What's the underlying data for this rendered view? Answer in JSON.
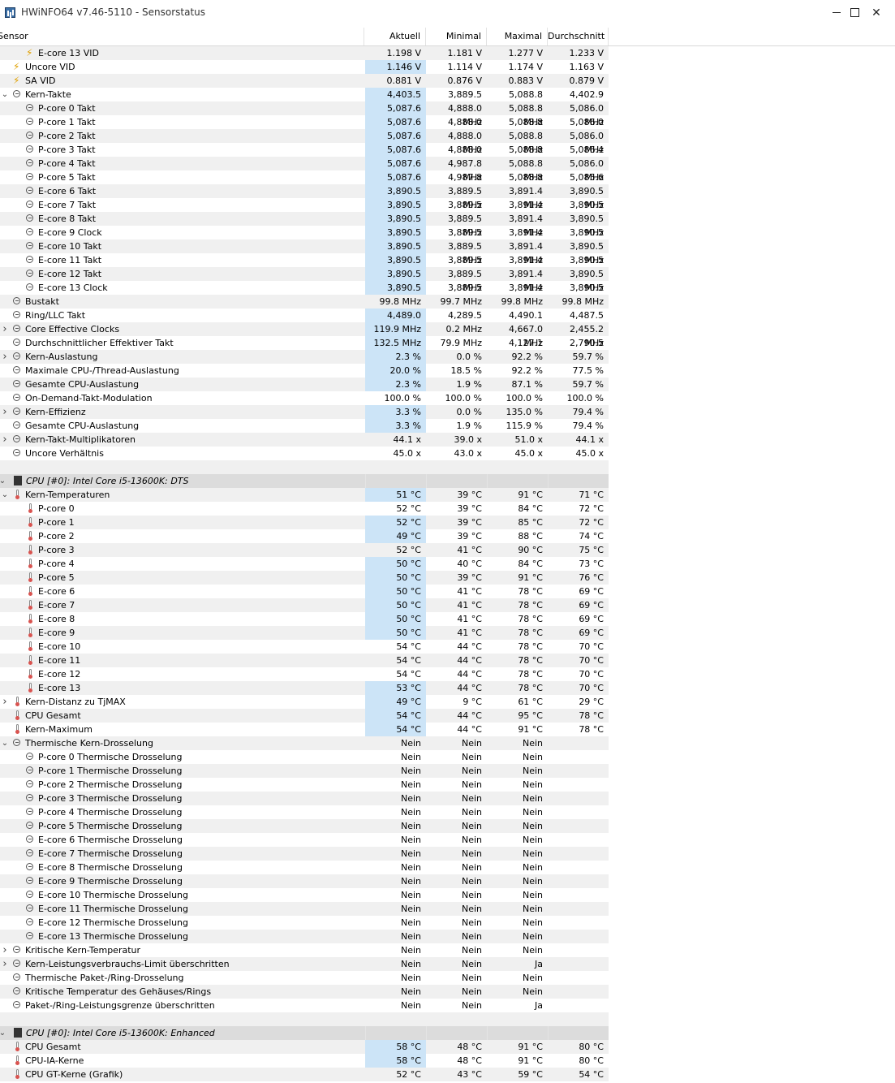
{
  "window": {
    "title": "HWiNFO64 v7.46-5110 - Sensorstatus",
    "minimize_label": "—",
    "maximize_label": "☐",
    "close_label": "✕"
  },
  "columns": [
    "Sensor",
    "Aktuell",
    "Minimal",
    "Maximal",
    "Durchschnitt"
  ],
  "colors": {
    "highlight": "#cce4f7",
    "group_row": "#dcdcdc",
    "alt_row": "#f0f0f0"
  },
  "rows": [
    {
      "indent": 2,
      "exp": "",
      "icon": "volt",
      "label": "E-core 13 VID",
      "v": [
        "1.198 V",
        "1.181 V",
        "1.277 V",
        "1.233 V"
      ],
      "hl": false
    },
    {
      "indent": 1,
      "exp": "",
      "icon": "volt",
      "label": "Uncore VID",
      "v": [
        "1.146 V",
        "1.114 V",
        "1.174 V",
        "1.163 V"
      ],
      "hl": true
    },
    {
      "indent": 1,
      "exp": "",
      "icon": "volt",
      "label": "SA VID",
      "v": [
        "0.881 V",
        "0.876 V",
        "0.883 V",
        "0.879 V"
      ],
      "hl": false
    },
    {
      "indent": 1,
      "exp": "down",
      "icon": "clock",
      "label": "Kern-Takte",
      "v": [
        "4,403.5 MHz",
        "3,889.5 MHz",
        "5,088.8 MHz",
        "4,402.9 MHz"
      ],
      "hl": true
    },
    {
      "indent": 2,
      "exp": "",
      "icon": "clock",
      "label": "P-core 0 Takt",
      "v": [
        "5,087.6 MHz",
        "4,888.0 MHz",
        "5,088.8 MHz",
        "5,086.0 MHz"
      ],
      "hl": true
    },
    {
      "indent": 2,
      "exp": "",
      "icon": "clock",
      "label": "P-core 1 Takt",
      "v": [
        "5,087.6 MHz",
        "4,888.0 MHz",
        "5,088.8 MHz",
        "5,086.0 MHz"
      ],
      "hl": true
    },
    {
      "indent": 2,
      "exp": "",
      "icon": "clock",
      "label": "P-core 2 Takt",
      "v": [
        "5,087.6 MHz",
        "4,888.0 MHz",
        "5,088.8 MHz",
        "5,086.0 MHz"
      ],
      "hl": true
    },
    {
      "indent": 2,
      "exp": "",
      "icon": "clock",
      "label": "P-core 3 Takt",
      "v": [
        "5,087.6 MHz",
        "4,888.0 MHz",
        "5,088.8 MHz",
        "5,086.4 MHz"
      ],
      "hl": true
    },
    {
      "indent": 2,
      "exp": "",
      "icon": "clock",
      "label": "P-core 4 Takt",
      "v": [
        "5,087.6 MHz",
        "4,987.8 MHz",
        "5,088.8 MHz",
        "5,086.0 MHz"
      ],
      "hl": true
    },
    {
      "indent": 2,
      "exp": "",
      "icon": "clock",
      "label": "P-core 5 Takt",
      "v": [
        "5,087.6 MHz",
        "4,987.8 MHz",
        "5,088.8 MHz",
        "5,085.6 MHz"
      ],
      "hl": true
    },
    {
      "indent": 2,
      "exp": "",
      "icon": "clock",
      "label": "E-core 6 Takt",
      "v": [
        "3,890.5 MHz",
        "3,889.5 MHz",
        "3,891.4 MHz",
        "3,890.5 MHz"
      ],
      "hl": true
    },
    {
      "indent": 2,
      "exp": "",
      "icon": "clock",
      "label": "E-core 7 Takt",
      "v": [
        "3,890.5 MHz",
        "3,889.5 MHz",
        "3,891.4 MHz",
        "3,890.5 MHz"
      ],
      "hl": true
    },
    {
      "indent": 2,
      "exp": "",
      "icon": "clock",
      "label": "E-core 8 Takt",
      "v": [
        "3,890.5 MHz",
        "3,889.5 MHz",
        "3,891.4 MHz",
        "3,890.5 MHz"
      ],
      "hl": true
    },
    {
      "indent": 2,
      "exp": "",
      "icon": "clock",
      "label": "E-core 9 Clock",
      "v": [
        "3,890.5 MHz",
        "3,889.5 MHz",
        "3,891.4 MHz",
        "3,890.5 MHz"
      ],
      "hl": true
    },
    {
      "indent": 2,
      "exp": "",
      "icon": "clock",
      "label": "E-core 10 Takt",
      "v": [
        "3,890.5 MHz",
        "3,889.5 MHz",
        "3,891.4 MHz",
        "3,890.5 MHz"
      ],
      "hl": true
    },
    {
      "indent": 2,
      "exp": "",
      "icon": "clock",
      "label": "E-core 11 Takt",
      "v": [
        "3,890.5 MHz",
        "3,889.5 MHz",
        "3,891.4 MHz",
        "3,890.5 MHz"
      ],
      "hl": true
    },
    {
      "indent": 2,
      "exp": "",
      "icon": "clock",
      "label": "E-core 12 Takt",
      "v": [
        "3,890.5 MHz",
        "3,889.5 MHz",
        "3,891.4 MHz",
        "3,890.5 MHz"
      ],
      "hl": true
    },
    {
      "indent": 2,
      "exp": "",
      "icon": "clock",
      "label": "E-core 13 Clock",
      "v": [
        "3,890.5 MHz",
        "3,889.5 MHz",
        "3,891.4 MHz",
        "3,890.5 MHz"
      ],
      "hl": true
    },
    {
      "indent": 1,
      "exp": "",
      "icon": "clock",
      "label": "Bustakt",
      "v": [
        "99.8 MHz",
        "99.7 MHz",
        "99.8 MHz",
        "99.8 MHz"
      ],
      "hl": false
    },
    {
      "indent": 1,
      "exp": "",
      "icon": "clock",
      "label": "Ring/LLC Takt",
      "v": [
        "4,489.0 MHz",
        "4,289.5 MHz",
        "4,490.1 MHz",
        "4,487.5 MHz"
      ],
      "hl": true
    },
    {
      "indent": 1,
      "exp": "right",
      "icon": "clock",
      "label": "Core Effective Clocks",
      "v": [
        "119.9 MHz",
        "0.2 MHz",
        "4,667.0 MHz",
        "2,455.2 MHz"
      ],
      "hl": true,
      "sub": true
    },
    {
      "indent": 1,
      "exp": "",
      "icon": "clock",
      "label": "Durchschnittlicher Effektiver Takt",
      "v": [
        "132.5 MHz",
        "79.9 MHz",
        "4,127.1 MHz",
        "2,790.5 MHz"
      ],
      "hl": true
    },
    {
      "indent": 1,
      "exp": "right",
      "icon": "clock",
      "label": "Kern-Auslastung",
      "v": [
        "2.3 %",
        "0.0 %",
        "92.2 %",
        "59.7 %"
      ],
      "hl": true,
      "sub": true
    },
    {
      "indent": 1,
      "exp": "",
      "icon": "clock",
      "label": "Maximale CPU-/Thread-Auslastung",
      "v": [
        "20.0 %",
        "18.5 %",
        "92.2 %",
        "77.5 %"
      ],
      "hl": true
    },
    {
      "indent": 1,
      "exp": "",
      "icon": "clock",
      "label": "Gesamte CPU-Auslastung",
      "v": [
        "2.3 %",
        "1.9 %",
        "87.1 %",
        "59.7 %"
      ],
      "hl": true
    },
    {
      "indent": 1,
      "exp": "",
      "icon": "clock",
      "label": "On-Demand-Takt-Modulation",
      "v": [
        "100.0 %",
        "100.0 %",
        "100.0 %",
        "100.0 %"
      ],
      "hl": false
    },
    {
      "indent": 1,
      "exp": "right",
      "icon": "clock",
      "label": "Kern-Effizienz",
      "v": [
        "3.3 %",
        "0.0 %",
        "135.0 %",
        "79.4 %"
      ],
      "hl": true,
      "sub": true
    },
    {
      "indent": 1,
      "exp": "",
      "icon": "clock",
      "label": "Gesamte CPU-Auslastung",
      "v": [
        "3.3 %",
        "1.9 %",
        "115.9 %",
        "79.4 %"
      ],
      "hl": true
    },
    {
      "indent": 1,
      "exp": "right",
      "icon": "clock",
      "label": "Kern-Takt-Multiplikatoren",
      "v": [
        "44.1 x",
        "39.0 x",
        "51.0 x",
        "44.1 x"
      ],
      "hl": false,
      "sub": true
    },
    {
      "indent": 1,
      "exp": "",
      "icon": "clock",
      "label": "Uncore Verhältnis",
      "v": [
        "45.0 x",
        "43.0 x",
        "45.0 x",
        "45.0 x"
      ],
      "hl": false
    },
    {
      "blank": true
    },
    {
      "group": true,
      "exp": "down",
      "icon": "cpu",
      "label": "CPU [#0]: Intel Core i5-13600K: DTS"
    },
    {
      "indent": 1,
      "exp": "down",
      "icon": "temp",
      "label": "Kern-Temperaturen",
      "v": [
        "51 °C",
        "39 °C",
        "91 °C",
        "71 °C"
      ],
      "hl": true,
      "sub": true
    },
    {
      "indent": 2,
      "exp": "",
      "icon": "temp",
      "label": "P-core 0",
      "v": [
        "52 °C",
        "39 °C",
        "84 °C",
        "72 °C"
      ],
      "hl": false
    },
    {
      "indent": 2,
      "exp": "",
      "icon": "temp",
      "label": "P-core 1",
      "v": [
        "52 °C",
        "39 °C",
        "85 °C",
        "72 °C"
      ],
      "hl": true
    },
    {
      "indent": 2,
      "exp": "",
      "icon": "temp",
      "label": "P-core 2",
      "v": [
        "49 °C",
        "39 °C",
        "88 °C",
        "74 °C"
      ],
      "hl": true
    },
    {
      "indent": 2,
      "exp": "",
      "icon": "temp",
      "label": "P-core 3",
      "v": [
        "52 °C",
        "41 °C",
        "90 °C",
        "75 °C"
      ],
      "hl": false
    },
    {
      "indent": 2,
      "exp": "",
      "icon": "temp",
      "label": "P-core 4",
      "v": [
        "50 °C",
        "40 °C",
        "84 °C",
        "73 °C"
      ],
      "hl": true
    },
    {
      "indent": 2,
      "exp": "",
      "icon": "temp",
      "label": "P-core 5",
      "v": [
        "50 °C",
        "39 °C",
        "91 °C",
        "76 °C"
      ],
      "hl": true
    },
    {
      "indent": 2,
      "exp": "",
      "icon": "temp",
      "label": "E-core 6",
      "v": [
        "50 °C",
        "41 °C",
        "78 °C",
        "69 °C"
      ],
      "hl": true
    },
    {
      "indent": 2,
      "exp": "",
      "icon": "temp",
      "label": "E-core 7",
      "v": [
        "50 °C",
        "41 °C",
        "78 °C",
        "69 °C"
      ],
      "hl": true
    },
    {
      "indent": 2,
      "exp": "",
      "icon": "temp",
      "label": "E-core 8",
      "v": [
        "50 °C",
        "41 °C",
        "78 °C",
        "69 °C"
      ],
      "hl": true
    },
    {
      "indent": 2,
      "exp": "",
      "icon": "temp",
      "label": "E-core 9",
      "v": [
        "50 °C",
        "41 °C",
        "78 °C",
        "69 °C"
      ],
      "hl": true
    },
    {
      "indent": 2,
      "exp": "",
      "icon": "temp",
      "label": "E-core 10",
      "v": [
        "54 °C",
        "44 °C",
        "78 °C",
        "70 °C"
      ],
      "hl": false
    },
    {
      "indent": 2,
      "exp": "",
      "icon": "temp",
      "label": "E-core 11",
      "v": [
        "54 °C",
        "44 °C",
        "78 °C",
        "70 °C"
      ],
      "hl": false
    },
    {
      "indent": 2,
      "exp": "",
      "icon": "temp",
      "label": "E-core 12",
      "v": [
        "54 °C",
        "44 °C",
        "78 °C",
        "70 °C"
      ],
      "hl": false
    },
    {
      "indent": 2,
      "exp": "",
      "icon": "temp",
      "label": "E-core 13",
      "v": [
        "53 °C",
        "44 °C",
        "78 °C",
        "70 °C"
      ],
      "hl": true
    },
    {
      "indent": 1,
      "exp": "right",
      "icon": "temp",
      "label": "Kern-Distanz zu TjMAX",
      "v": [
        "49 °C",
        "9 °C",
        "61 °C",
        "29 °C"
      ],
      "hl": true,
      "sub": true
    },
    {
      "indent": 1,
      "exp": "",
      "icon": "temp",
      "label": "CPU Gesamt",
      "v": [
        "54 °C",
        "44 °C",
        "95 °C",
        "78 °C"
      ],
      "hl": true
    },
    {
      "indent": 1,
      "exp": "",
      "icon": "temp",
      "label": "Kern-Maximum",
      "v": [
        "54 °C",
        "44 °C",
        "91 °C",
        "78 °C"
      ],
      "hl": true
    },
    {
      "indent": 1,
      "exp": "down",
      "icon": "clock",
      "label": "Thermische Kern-Drosselung",
      "v": [
        "Nein",
        "Nein",
        "Nein",
        ""
      ],
      "hl": false,
      "sub": true
    },
    {
      "indent": 2,
      "exp": "",
      "icon": "clock",
      "label": "P-core 0 Thermische Drosselung",
      "v": [
        "Nein",
        "Nein",
        "Nein",
        ""
      ],
      "hl": false
    },
    {
      "indent": 2,
      "exp": "",
      "icon": "clock",
      "label": "P-core 1 Thermische Drosselung",
      "v": [
        "Nein",
        "Nein",
        "Nein",
        ""
      ],
      "hl": false
    },
    {
      "indent": 2,
      "exp": "",
      "icon": "clock",
      "label": "P-core 2 Thermische Drosselung",
      "v": [
        "Nein",
        "Nein",
        "Nein",
        ""
      ],
      "hl": false
    },
    {
      "indent": 2,
      "exp": "",
      "icon": "clock",
      "label": "P-core 3 Thermische Drosselung",
      "v": [
        "Nein",
        "Nein",
        "Nein",
        ""
      ],
      "hl": false
    },
    {
      "indent": 2,
      "exp": "",
      "icon": "clock",
      "label": "P-core 4 Thermische Drosselung",
      "v": [
        "Nein",
        "Nein",
        "Nein",
        ""
      ],
      "hl": false
    },
    {
      "indent": 2,
      "exp": "",
      "icon": "clock",
      "label": "P-core 5 Thermische Drosselung",
      "v": [
        "Nein",
        "Nein",
        "Nein",
        ""
      ],
      "hl": false
    },
    {
      "indent": 2,
      "exp": "",
      "icon": "clock",
      "label": "E-core 6 Thermische Drosselung",
      "v": [
        "Nein",
        "Nein",
        "Nein",
        ""
      ],
      "hl": false
    },
    {
      "indent": 2,
      "exp": "",
      "icon": "clock",
      "label": "E-core 7 Thermische Drosselung",
      "v": [
        "Nein",
        "Nein",
        "Nein",
        ""
      ],
      "hl": false
    },
    {
      "indent": 2,
      "exp": "",
      "icon": "clock",
      "label": "E-core 8 Thermische Drosselung",
      "v": [
        "Nein",
        "Nein",
        "Nein",
        ""
      ],
      "hl": false
    },
    {
      "indent": 2,
      "exp": "",
      "icon": "clock",
      "label": "E-core 9 Thermische Drosselung",
      "v": [
        "Nein",
        "Nein",
        "Nein",
        ""
      ],
      "hl": false
    },
    {
      "indent": 2,
      "exp": "",
      "icon": "clock",
      "label": "E-core 10 Thermische Drosselung",
      "v": [
        "Nein",
        "Nein",
        "Nein",
        ""
      ],
      "hl": false
    },
    {
      "indent": 2,
      "exp": "",
      "icon": "clock",
      "label": "E-core 11 Thermische Drosselung",
      "v": [
        "Nein",
        "Nein",
        "Nein",
        ""
      ],
      "hl": false
    },
    {
      "indent": 2,
      "exp": "",
      "icon": "clock",
      "label": "E-core 12 Thermische Drosselung",
      "v": [
        "Nein",
        "Nein",
        "Nein",
        ""
      ],
      "hl": false
    },
    {
      "indent": 2,
      "exp": "",
      "icon": "clock",
      "label": "E-core 13 Thermische Drosselung",
      "v": [
        "Nein",
        "Nein",
        "Nein",
        ""
      ],
      "hl": false
    },
    {
      "indent": 1,
      "exp": "right",
      "icon": "clock",
      "label": "Kritische Kern-Temperatur",
      "v": [
        "Nein",
        "Nein",
        "Nein",
        ""
      ],
      "hl": false,
      "sub": true
    },
    {
      "indent": 1,
      "exp": "right",
      "icon": "clock",
      "label": "Kern-Leistungsverbrauchs-Limit überschritten",
      "v": [
        "Nein",
        "Nein",
        "Ja",
        ""
      ],
      "hl": false,
      "sub": true
    },
    {
      "indent": 1,
      "exp": "",
      "icon": "clock",
      "label": "Thermische Paket-/Ring-Drosselung",
      "v": [
        "Nein",
        "Nein",
        "Nein",
        ""
      ],
      "hl": false
    },
    {
      "indent": 1,
      "exp": "",
      "icon": "clock",
      "label": "Kritische Temperatur des Gehäuses/Rings",
      "v": [
        "Nein",
        "Nein",
        "Nein",
        ""
      ],
      "hl": false
    },
    {
      "indent": 1,
      "exp": "",
      "icon": "clock",
      "label": "Paket-/Ring-Leistungsgrenze überschritten",
      "v": [
        "Nein",
        "Nein",
        "Ja",
        ""
      ],
      "hl": false
    },
    {
      "blank": true
    },
    {
      "group": true,
      "exp": "down",
      "icon": "cpu",
      "label": "CPU [#0]: Intel Core i5-13600K: Enhanced"
    },
    {
      "indent": 1,
      "exp": "",
      "icon": "temp",
      "label": "CPU Gesamt",
      "v": [
        "58 °C",
        "48 °C",
        "91 °C",
        "80 °C"
      ],
      "hl": true
    },
    {
      "indent": 1,
      "exp": "",
      "icon": "temp",
      "label": "CPU-IA-Kerne",
      "v": [
        "58 °C",
        "48 °C",
        "91 °C",
        "80 °C"
      ],
      "hl": true
    },
    {
      "indent": 1,
      "exp": "",
      "icon": "temp",
      "label": "CPU GT-Kerne (Grafik)",
      "v": [
        "52 °C",
        "43 °C",
        "59 °C",
        "54 °C"
      ],
      "hl": false
    }
  ]
}
